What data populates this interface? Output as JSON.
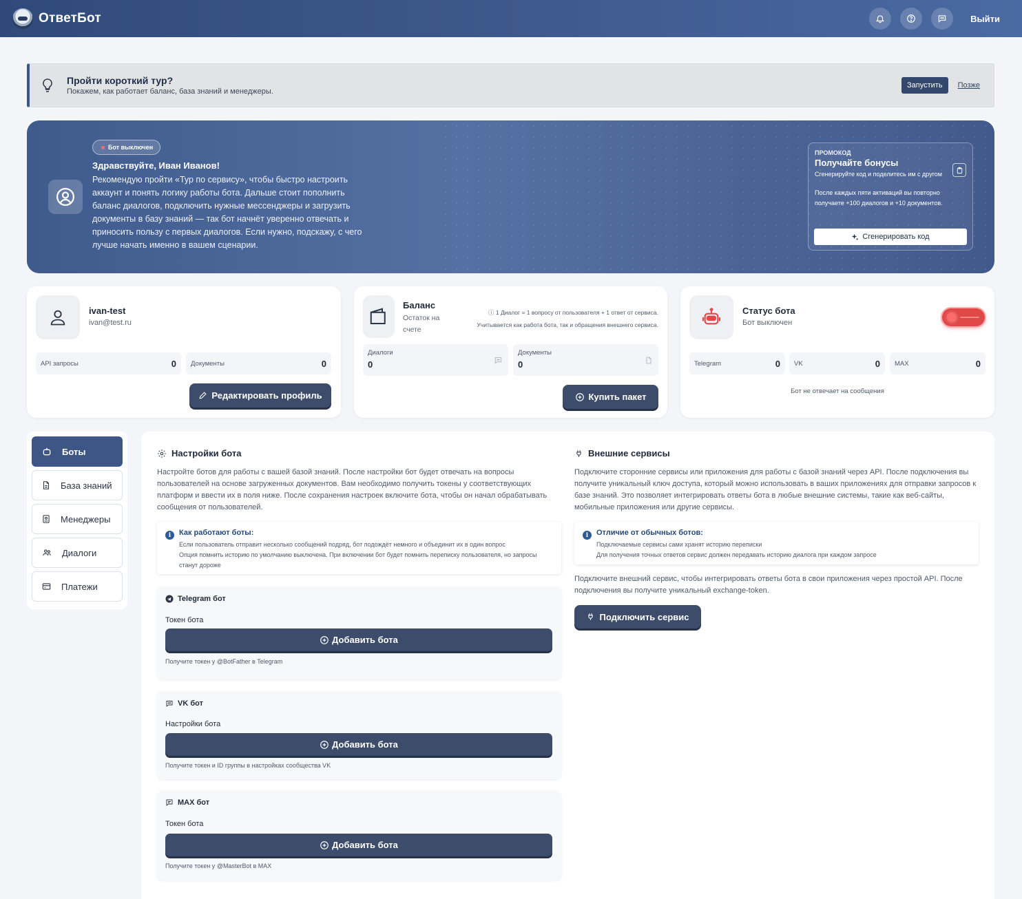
{
  "header": {
    "brand": "ОтветБот",
    "logout": "Выйти",
    "icons": [
      "bell-icon",
      "help-icon",
      "chat-icon"
    ]
  },
  "tour": {
    "title": "Пройти короткий тур?",
    "subtitle": "Покажем, как работает баланс, база знаний и менеджеры.",
    "start": "Запустить",
    "later": "Позже"
  },
  "hero": {
    "status_pill": "Бот выключен",
    "greeting": "Здравствуйте, Иван Иванов!",
    "text": "Рекомендую пройти «Тур по сервису», чтобы быстро настроить аккаунт и понять логику работы бота. Дальше стоит пополнить баланс диалогов, подключить нужные мессенджеры и загрузить документы в базу знаний — так бот начнёт уверенно отвечать и приносить пользу с первых диалогов. Если нужно, подскажу, с чего лучше начать именно в вашем сценарии.",
    "promo": {
      "label": "ПРОМОКОД",
      "title": "Получайте бонусы",
      "text": "Сгенерируйте код и поделитесь им с другом",
      "text2": "После каждых пяти активаций вы повторно получаете +100 диалогов и +10 документов.",
      "button": "Сгенерировать код"
    }
  },
  "profile": {
    "name": "ivan-test",
    "email": "ivan@test.ru",
    "api_label": "API запросы",
    "api_value": "0",
    "docs_label": "Документы",
    "docs_value": "0",
    "edit_button": "Редактировать профиль"
  },
  "balance": {
    "title": "Баланс",
    "subtitle": "Остаток на счете",
    "note1": "1 Диалог = 1 вопросу от пользователя + 1 ответ от сервиса.",
    "note2": "Учитывается как работа бота, так и обращения внешнего сервиса.",
    "dialogs_label": "Диалоги",
    "dialogs_value": "0",
    "docs_label": "Документы",
    "docs_value": "0",
    "buy_button": "Купить пакет"
  },
  "bot_status": {
    "title": "Статус бота",
    "subtitle": "Бот выключен",
    "enabled": false,
    "telegram_label": "Telegram",
    "telegram_value": "0",
    "vk_label": "VK",
    "vk_value": "0",
    "max_label": "MAX",
    "max_value": "0",
    "note": "Бот не отвечает на сообщения"
  },
  "sidebar": {
    "items": [
      {
        "label": "Боты",
        "icon": "bot-icon",
        "active": true
      },
      {
        "label": "База знаний",
        "icon": "document-icon",
        "active": false
      },
      {
        "label": "Менеджеры",
        "icon": "badge-icon",
        "active": false
      },
      {
        "label": "Диалоги",
        "icon": "users-icon",
        "active": false
      },
      {
        "label": "Платежи",
        "icon": "card-icon",
        "active": false
      }
    ]
  },
  "bot_settings": {
    "title": "Настройки бота",
    "text": "Настройте ботов для работы с вашей базой знаний. После настройки бот будет отвечать на вопросы пользователей на основе загруженных документов. Вам необходимо получить токены у соответствующих платформ и ввести их в поля ниже. После сохранения настроек включите бота, чтобы он начал обрабатывать сообщения от пользователей.",
    "info_title": "Как работают боты:",
    "info_line1": "Если пользователь отправит несколько сообщений подряд, бот подождёт немного и объединит их в один вопрос",
    "info_line2": "Опция помнить историю по умолчанию выключена. При включении бот будет помнить переписку пользователя, но запросы станут дороже",
    "bots": [
      {
        "name": "Telegram бот",
        "field": "Токен бота",
        "button": "Добавить бота",
        "hint": "Получите токен у @BotFather в Telegram"
      },
      {
        "name": "VK бот",
        "field": "Настройки бота",
        "button": "Добавить бота",
        "hint": "Получите токен и ID группы в настройках сообщества VK"
      },
      {
        "name": "MAX бот",
        "field": "Токен бота",
        "button": "Добавить бота",
        "hint": "Получите токен у @MasterBot в MAX"
      }
    ]
  },
  "external": {
    "title": "Внешние сервисы",
    "text": "Подключите сторонние сервисы или приложения для работы с базой знаний через API. После подключения вы получите уникальный ключ доступа, который можно использовать в ваших приложениях для отправки запросов к базе знаний. Это позволяет интегрировать ответы бота в любые внешние системы, такие как веб-сайты, мобильные приложения или другие сервисы.",
    "info_title": "Отличие от обычных ботов:",
    "info_line1": "Подключаемые сервисы сами хранят историю переписки",
    "info_line2": "Для получения точных ответов сервис должен передавать историю диалога при каждом запросе",
    "text2": "Подключите внешний сервис, чтобы интегрировать ответы бота в свои приложения через простой API. После подключения вы получите уникальный exchange-token.",
    "button": "Подключить сервис"
  }
}
